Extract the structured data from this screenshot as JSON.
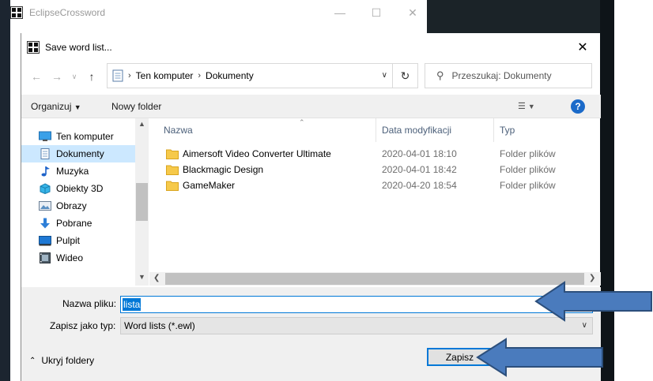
{
  "parent_window": {
    "title": "EclipseCrossword",
    "minimize_icon": "minimize-icon",
    "maximize_icon": "maximize-icon",
    "close_icon": "close-icon"
  },
  "dialog": {
    "title": "Save word list...",
    "close_icon": "close-icon"
  },
  "nav": {
    "back_icon": "arrow-left-icon",
    "forward_icon": "arrow-right-icon",
    "recent_icon": "chevron-down-icon",
    "up_icon": "arrow-up-icon",
    "breadcrumbs": [
      "Ten komputer",
      "Dokumenty"
    ],
    "refresh_icon": "refresh-icon",
    "search_placeholder": "Przeszukaj: Dokumenty"
  },
  "toolbar": {
    "organize": "Organizuj",
    "new_folder": "Nowy folder"
  },
  "sidebar": {
    "items": [
      {
        "label": "Ten komputer",
        "icon": "computer-icon"
      },
      {
        "label": "Dokumenty",
        "icon": "documents-icon"
      },
      {
        "label": "Muzyka",
        "icon": "music-icon"
      },
      {
        "label": "Obiekty 3D",
        "icon": "objects-3d-icon"
      },
      {
        "label": "Obrazy",
        "icon": "pictures-icon"
      },
      {
        "label": "Pobrane",
        "icon": "downloads-icon"
      },
      {
        "label": "Pulpit",
        "icon": "desktop-icon"
      },
      {
        "label": "Wideo",
        "icon": "video-icon"
      }
    ],
    "selected_index": 1
  },
  "files": {
    "columns": [
      "Nazwa",
      "Data modyfikacji",
      "Typ"
    ],
    "rows": [
      {
        "name": "Aimersoft Video Converter Ultimate",
        "date": "2020-04-01 18:10",
        "type": "Folder plików"
      },
      {
        "name": "Blackmagic Design",
        "date": "2020-04-01 18:42",
        "type": "Folder plików"
      },
      {
        "name": "GameMaker",
        "date": "2020-04-20 18:54",
        "type": "Folder plików"
      }
    ]
  },
  "form": {
    "filename_label": "Nazwa pliku:",
    "filename_value": "lista",
    "savetype_label": "Zapisz jako typ:",
    "savetype_value": "Word lists (*.ewl)",
    "hide_folders": "Ukryj foldery",
    "save_button": "Zapisz"
  },
  "colors": {
    "accent": "#0078d7",
    "annotation_arrow_fill": "#4a7bbd",
    "annotation_arrow_stroke": "#2c4f7c"
  }
}
